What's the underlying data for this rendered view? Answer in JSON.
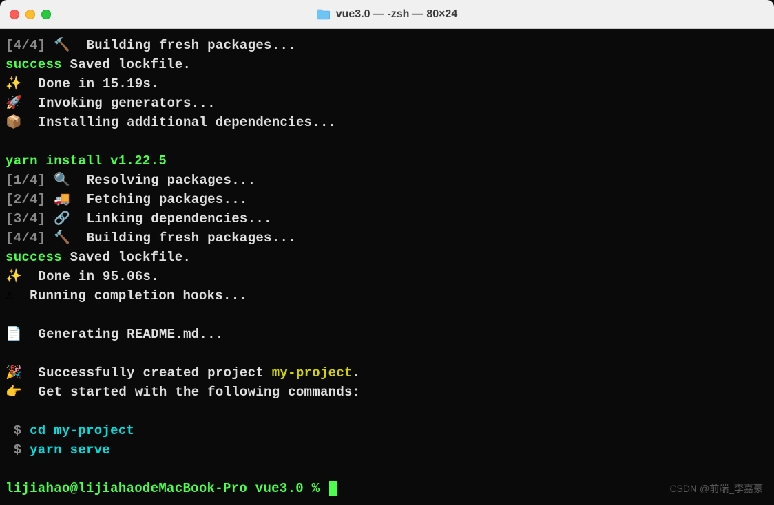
{
  "titlebar": {
    "title": "vue3.0 — -zsh — 80×24"
  },
  "terminal": {
    "step4_1": "[4/4]",
    "step4_msg": "Building fresh packages...",
    "success1": "success",
    "success1_msg": "Saved lockfile.",
    "done1": "Done in 15.19s.",
    "invoking": "Invoking generators...",
    "installing": "Installing additional dependencies...",
    "yarn_install": "yarn install v1.22.5",
    "step1": "[1/4]",
    "step1_msg": "Resolving packages...",
    "step2": "[2/4]",
    "step2_msg": "Fetching packages...",
    "step3": "[3/4]",
    "step3_msg": "Linking dependencies...",
    "step4_2": "[4/4]",
    "step4_2_msg": "Building fresh packages...",
    "success2": "success",
    "success2_msg": "Saved lockfile.",
    "done2": "Done in 95.06s.",
    "running": "Running completion hooks...",
    "generating": "Generating README.md...",
    "success_created": "Successfully created project ",
    "project_name": "my-project",
    "period": ".",
    "get_started": "Get started with the following commands:",
    "cmd1_prompt": " $ ",
    "cmd1": "cd my-project",
    "cmd2_prompt": " $ ",
    "cmd2": "yarn serve",
    "prompt": "lijiahao@lijiahaodeMacBook-Pro vue3.0 % "
  },
  "watermark": "CSDN @前端_李嘉豪"
}
